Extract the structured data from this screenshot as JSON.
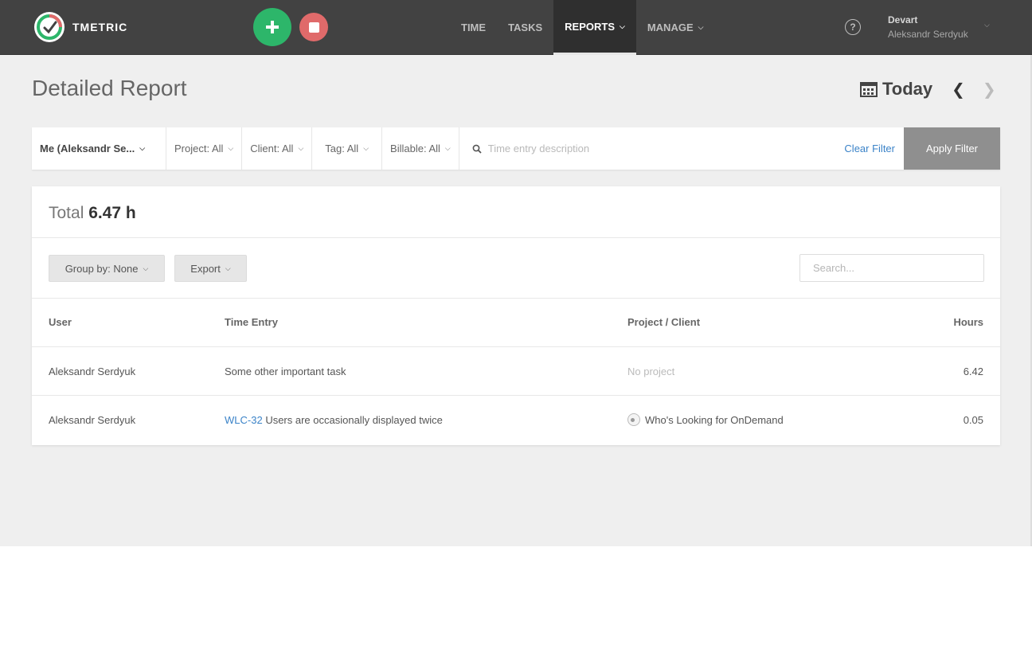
{
  "app": {
    "name": "TMETRIC",
    "brand_color": "#2db66a",
    "stop_color": "#e06a6a"
  },
  "nav": {
    "items": [
      {
        "label": "TIME"
      },
      {
        "label": "TASKS"
      },
      {
        "label": "REPORTS",
        "active": true
      },
      {
        "label": "MANAGE"
      }
    ]
  },
  "account": {
    "org": "Devart",
    "user": "Aleksandr Serdyuk"
  },
  "header": {
    "title": "Detailed Report",
    "period": "Today"
  },
  "filters": {
    "person": "Me (Aleksandr Se...",
    "project": "Project: All",
    "client": "Client: All",
    "tag": "Tag: All",
    "billable": "Billable: All",
    "description_placeholder": "Time entry description",
    "clear_label": "Clear Filter",
    "apply_label": "Apply Filter"
  },
  "report": {
    "total_label": "Total",
    "total_value": "6.47 h",
    "group_by_label": "Group by: None",
    "export_label": "Export",
    "search_placeholder": "Search...",
    "columns": {
      "user": "User",
      "entry": "Time Entry",
      "project": "Project / Client",
      "hours": "Hours"
    },
    "rows": [
      {
        "user": "Aleksandr Serdyuk",
        "task_key": "",
        "entry": "Some other important task",
        "project": "No project",
        "hours": "6.42"
      },
      {
        "user": "Aleksandr Serdyuk",
        "task_key": "WLC-32",
        "entry": "Users are occasionally displayed twice",
        "project": "Who's Looking for OnDemand",
        "hours": "0.05"
      }
    ]
  },
  "icons": {
    "logo": "tmetric-logo-icon",
    "start": "plus-icon",
    "stop": "stop-icon",
    "help": "help-icon",
    "calendar": "calendar-icon",
    "search": "search-icon"
  }
}
